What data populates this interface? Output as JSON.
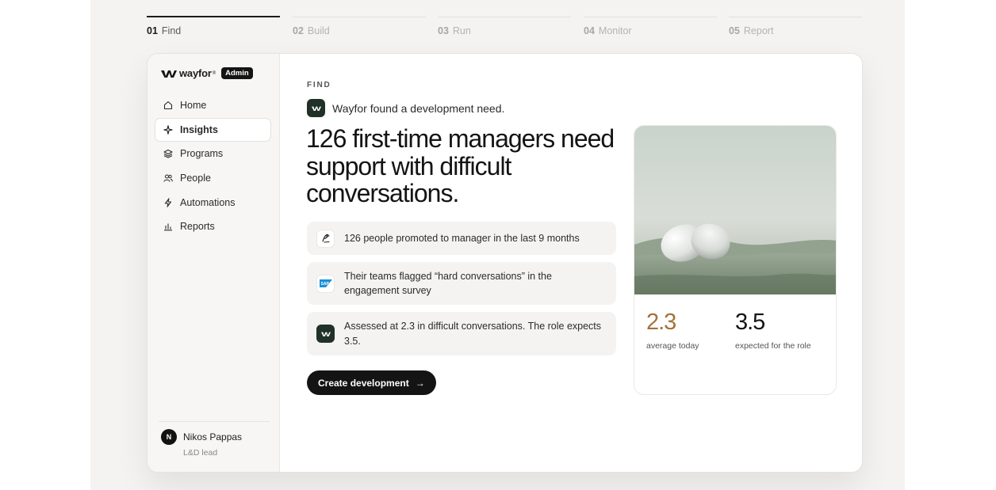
{
  "steps": [
    {
      "num": "01",
      "label": "Find",
      "active": true
    },
    {
      "num": "02",
      "label": "Build"
    },
    {
      "num": "03",
      "label": "Run"
    },
    {
      "num": "04",
      "label": "Monitor"
    },
    {
      "num": "05",
      "label": "Report"
    }
  ],
  "brand": {
    "name": "wayfor",
    "badge": "Admin"
  },
  "sidebar": {
    "items": [
      {
        "label": "Home",
        "icon": "home-icon"
      },
      {
        "label": "Insights",
        "icon": "sparkle-icon",
        "active": true
      },
      {
        "label": "Programs",
        "icon": "layers-icon"
      },
      {
        "label": "People",
        "icon": "people-icon"
      },
      {
        "label": "Automations",
        "icon": "bolt-icon"
      },
      {
        "label": "Reports",
        "icon": "bar-chart-icon"
      }
    ]
  },
  "user": {
    "initial": "N",
    "name": "Nikos Pappas",
    "role": "L&D lead"
  },
  "main": {
    "kicker": "FIND",
    "found": "Wayfor found a development need.",
    "headline": "126 first-time managers need support with difficult conversations.",
    "reasons": [
      {
        "text": "126 people promoted to manager in the last 9 months",
        "icon": "signature-icon"
      },
      {
        "text": "Their teams flagged “hard conversations” in the engagement survey",
        "icon": "sap-logo-icon"
      },
      {
        "text": "Assessed at 2.3 in difficult conversations. The role expects 3.5.",
        "icon": "wayfor-logo-icon"
      }
    ],
    "cta": "Create development"
  },
  "card": {
    "current": {
      "value": "2.3",
      "caption": "average today"
    },
    "expected": {
      "value": "3.5",
      "caption": "expected for the role"
    }
  },
  "colors": {
    "accent": "#a2733b",
    "brand_dark": "#203128",
    "ink": "#141414"
  }
}
